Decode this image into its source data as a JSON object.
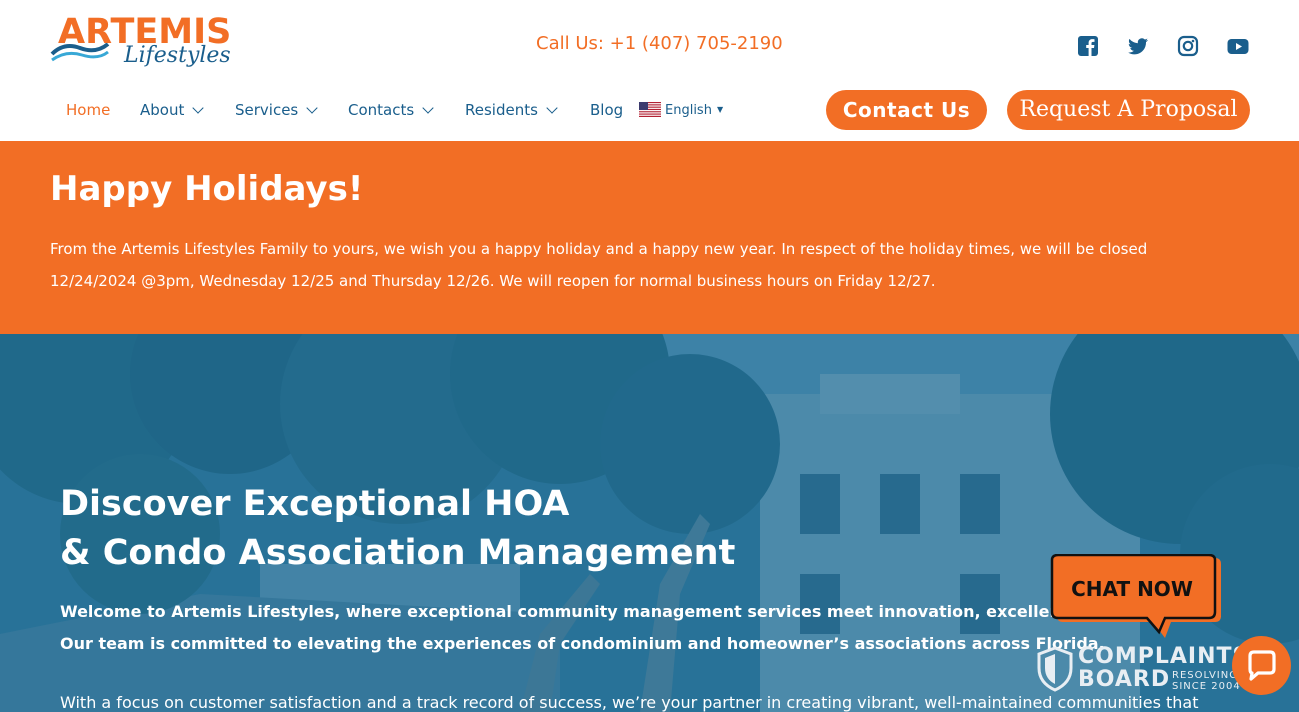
{
  "logo": {
    "main": "ARTEMIS",
    "sub": "Lifestyles"
  },
  "header": {
    "phone": "Call Us: +1 (407) 705-2190"
  },
  "social": [
    "facebook-icon",
    "twitter-icon",
    "instagram-icon",
    "youtube-icon"
  ],
  "nav": {
    "items": [
      {
        "label": "Home",
        "active": true
      },
      {
        "label": "About"
      },
      {
        "label": "Services"
      },
      {
        "label": "Contacts"
      },
      {
        "label": "Residents"
      },
      {
        "label": "Blog"
      }
    ],
    "language": "English"
  },
  "buttons": {
    "contact": "Contact Us",
    "proposal": "Request A Proposal"
  },
  "banner": {
    "title": "Happy Holidays!",
    "text": "From the Artemis Lifestyles Family to yours, we wish you a happy holiday and a happy new year. In respect of the holiday times, we will be closed 12/24/2024 @3pm, Wednesday 12/25 and Thursday 12/26. We will reopen for normal business hours on Friday 12/27."
  },
  "hero": {
    "title_line1": "Discover Exceptional HOA",
    "title_line2": "& Condo Association Management",
    "p1": "Welcome to Artemis Lifestyles, where exceptional community management services meet innovation, excellence, and efficiency. Our team is committed to elevating the experiences of condominium and homeowner’s associations across Florida.",
    "p2": "With a focus on customer satisfaction and a track record of success, we’re your partner in creating vibrant, well-maintained communities that"
  },
  "chat": {
    "badge": "CHAT NOW"
  },
  "complaints_board": {
    "line1": "COMPLAINTS",
    "line2": "BOARD",
    "sub1": "RESOLVING",
    "sub2": "SINCE 2004"
  },
  "colors": {
    "accent": "#f26e25",
    "nav": "#1a5e8c",
    "hero_overlay": "#166796"
  }
}
